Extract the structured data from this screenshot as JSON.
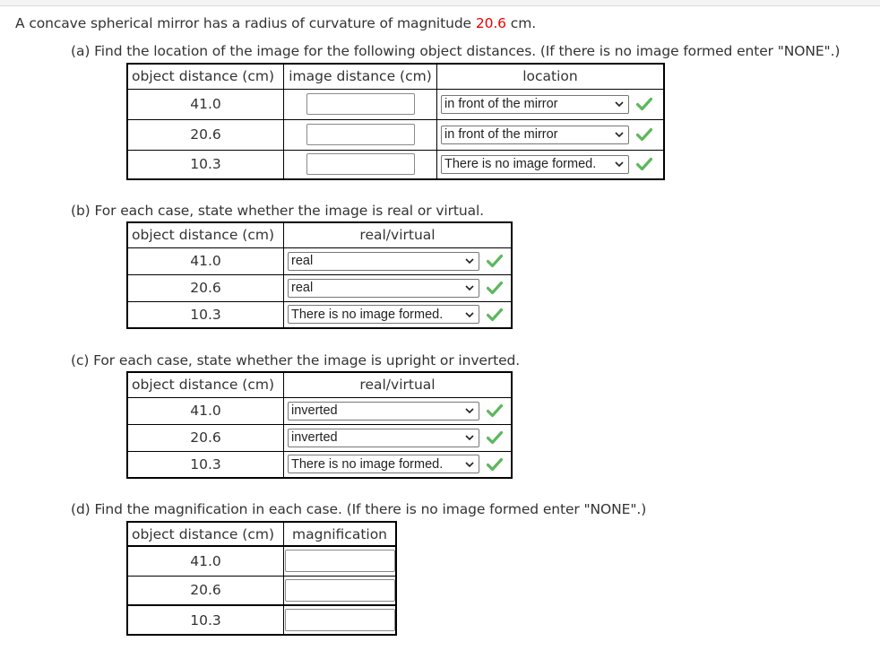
{
  "intro": {
    "text_before": "A concave spherical mirror has a radius of curvature of magnitude ",
    "radius_value": "20.6",
    "text_after": " cm."
  },
  "accent_colors": {
    "given_value": "#ee0000",
    "correct_check": "#5cb85c"
  },
  "part_a": {
    "prompt": "(a) Find the location of the image for the following object distances. (If there is no image formed enter \"NONE\".)",
    "headers": [
      "object distance (cm)",
      "image distance (cm)",
      "location"
    ],
    "rows": [
      {
        "object_distance": "41.0",
        "image_distance_value": "",
        "location": "in front of the mirror",
        "status_icon": "check-icon"
      },
      {
        "object_distance": "20.6",
        "image_distance_value": "",
        "location": "in front of the mirror",
        "status_icon": "check-icon"
      },
      {
        "object_distance": "10.3",
        "image_distance_value": "",
        "location": "There is no image formed.",
        "status_icon": "check-icon"
      }
    ]
  },
  "part_b": {
    "prompt": "(b) For each case, state whether the image is real or virtual.",
    "headers": [
      "object distance (cm)",
      "real/virtual"
    ],
    "rows": [
      {
        "object_distance": "41.0",
        "selection": "real",
        "status_icon": "check-icon"
      },
      {
        "object_distance": "20.6",
        "selection": "real",
        "status_icon": "check-icon"
      },
      {
        "object_distance": "10.3",
        "selection": "There is no image formed.",
        "status_icon": "check-icon"
      }
    ]
  },
  "part_c": {
    "prompt": "(c) For each case, state whether the image is upright or inverted.",
    "headers": [
      "object distance (cm)",
      "real/virtual"
    ],
    "rows": [
      {
        "object_distance": "41.0",
        "selection": "inverted",
        "status_icon": "check-icon"
      },
      {
        "object_distance": "20.6",
        "selection": "inverted",
        "status_icon": "check-icon"
      },
      {
        "object_distance": "10.3",
        "selection": "There is no image formed.",
        "status_icon": "check-icon"
      }
    ]
  },
  "part_d": {
    "prompt": "(d) Find the magnification in each case. (If there is no image formed enter \"NONE\".)",
    "headers": [
      "object distance (cm)",
      "magnification"
    ],
    "rows": [
      {
        "object_distance": "41.0",
        "magnification_value": ""
      },
      {
        "object_distance": "20.6",
        "magnification_value": ""
      },
      {
        "object_distance": "10.3",
        "magnification_value": ""
      }
    ]
  }
}
